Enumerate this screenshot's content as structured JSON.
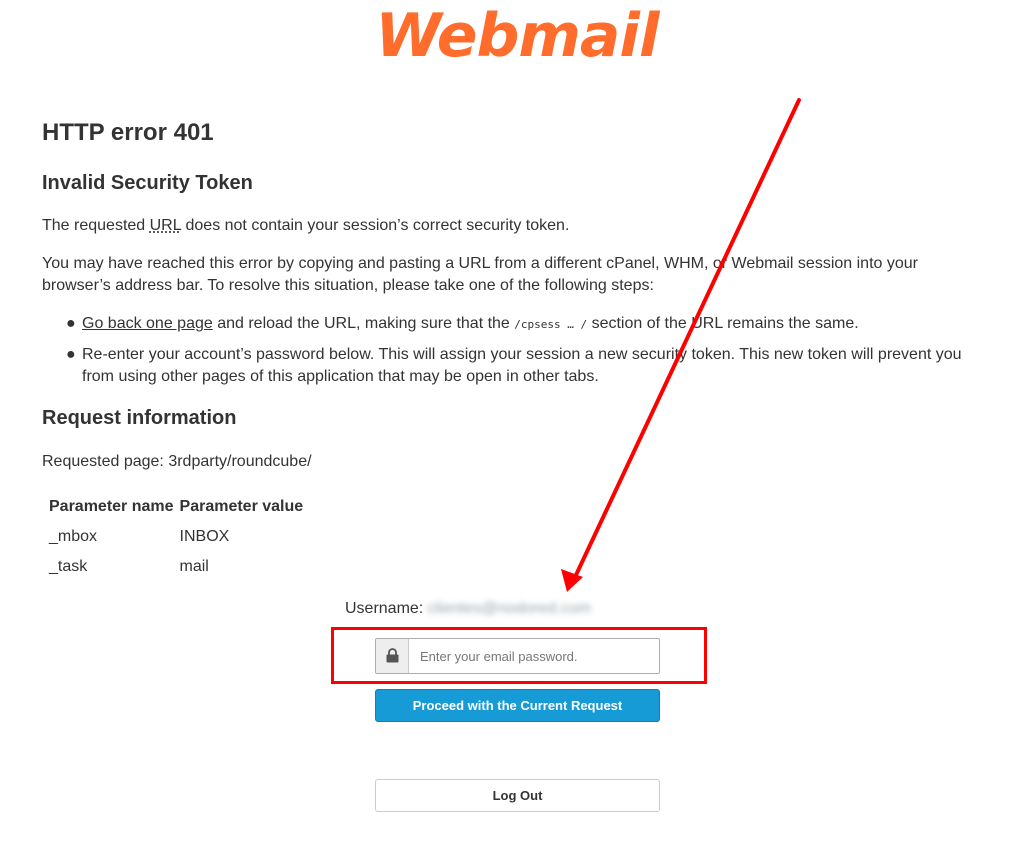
{
  "logo": {
    "text": "Webmail",
    "color": "#ff6c2c"
  },
  "error": {
    "title": "HTTP error 401",
    "subtitle": "Invalid Security Token",
    "intro_before": "The requested ",
    "intro_abbr": "URL",
    "intro_after": " does not contain your session’s correct security token.",
    "reached_text": "You may have reached this error by copying and pasting a URL from a different cPanel, WHM, or Webmail session into your browser’s address bar. To resolve this situation, please take one of the following steps:",
    "steps": [
      {
        "link": "Go back one page",
        "before_code": " and reload the URL, making sure that the ",
        "code": "/cpsess … /",
        "after_code": " section of the URL remains the same."
      },
      {
        "text": "Re-enter your account’s password below. This will assign your session a new security token. This new token will prevent you from using other pages of this application that may be open in other tabs."
      }
    ]
  },
  "request_info": {
    "heading": "Request information",
    "requested_page_label": "Requested page: ",
    "requested_page_value": "3rdparty/roundcube/",
    "table": {
      "headers": [
        "Parameter name",
        "Parameter value"
      ],
      "rows": [
        [
          "_mbox",
          "INBOX"
        ],
        [
          "_task",
          "mail"
        ]
      ]
    }
  },
  "login": {
    "username_label": "Username:",
    "username_value": "clientes@nodored.com",
    "password_placeholder": "Enter your email password.",
    "proceed_label": "Proceed with the Current Request",
    "logout_label": "Log Out"
  },
  "colors": {
    "annotation_red": "#ff0000",
    "proceed_button": "#179bd7"
  }
}
